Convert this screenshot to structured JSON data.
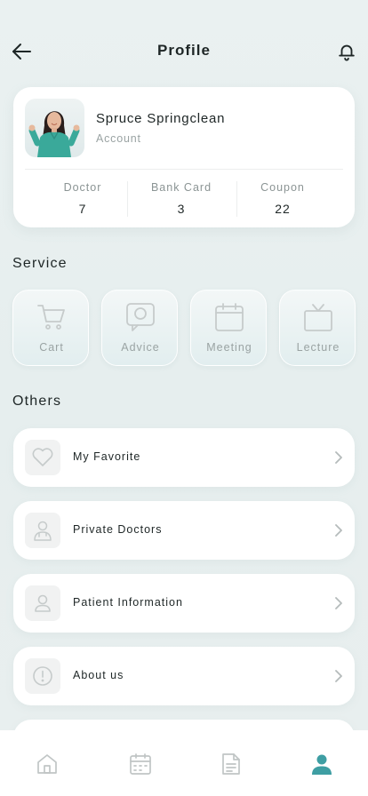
{
  "header": {
    "title": "Profile",
    "back_icon": "arrow-left-icon",
    "notification_icon": "bell-icon"
  },
  "profile": {
    "name": "Spruce Springclean",
    "subtitle": "Account",
    "stats": [
      {
        "label": "Doctor",
        "value": "7"
      },
      {
        "label": "Bank Card",
        "value": "3"
      },
      {
        "label": "Coupon",
        "value": "22"
      }
    ]
  },
  "service": {
    "title": "Service",
    "items": [
      {
        "label": "Cart",
        "icon": "cart-icon"
      },
      {
        "label": "Advice",
        "icon": "chat-bubble-icon"
      },
      {
        "label": "Meeting",
        "icon": "calendar-icon"
      },
      {
        "label": "Lecture",
        "icon": "tv-icon"
      }
    ]
  },
  "others": {
    "title": "Others",
    "items": [
      {
        "label": "My Favorite",
        "icon": "heart-icon"
      },
      {
        "label": "Private Doctors",
        "icon": "doctor-icon"
      },
      {
        "label": "Patient Information",
        "icon": "user-icon"
      },
      {
        "label": "About us",
        "icon": "info-icon"
      }
    ]
  },
  "nav": {
    "items": [
      {
        "icon": "home-icon",
        "active": false
      },
      {
        "icon": "calendar-icon",
        "active": false
      },
      {
        "icon": "document-icon",
        "active": false
      },
      {
        "icon": "profile-icon",
        "active": true
      }
    ]
  },
  "colors": {
    "accent": "#3e9ea3",
    "background": "#e8efef",
    "icon_muted": "#c6cbcb",
    "text_muted": "#9aa3a3"
  }
}
